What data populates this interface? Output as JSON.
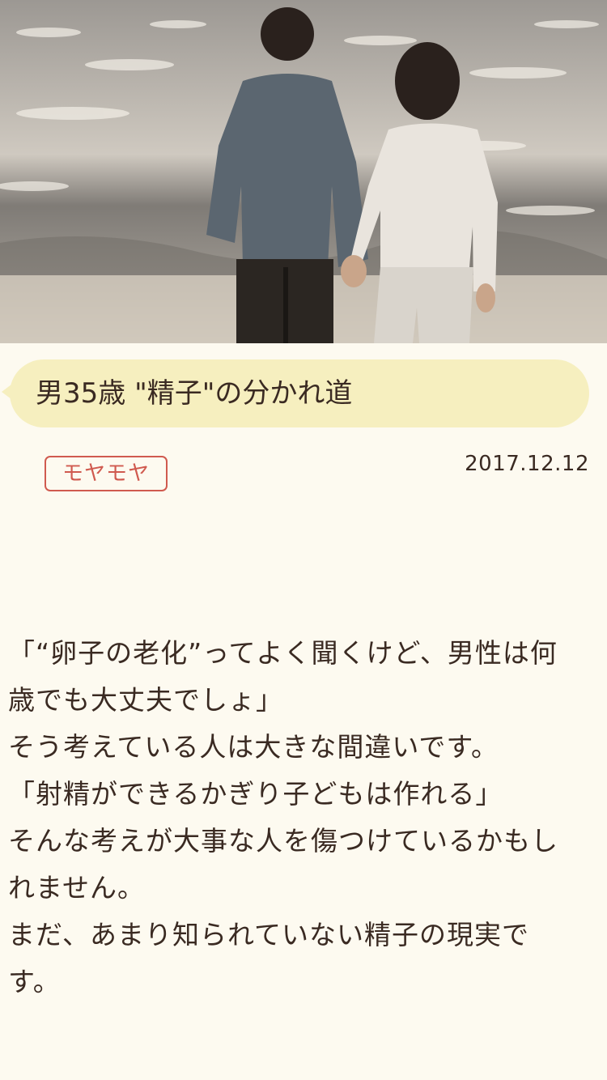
{
  "article": {
    "title": "男35歳 \"精子\"の分かれ道",
    "tag": "モヤモヤ",
    "date": "2017.12.12",
    "image_alt": "海辺で手をつなぐ男女の後ろ姿",
    "body_lines": [
      "「“卵子の老化”ってよく聞くけど、男性は何歳でも大丈夫でしょ」",
      "そう考えている人は大きな間違いです。",
      "「射精ができるかぎり子どもは作れる」",
      "そんな考えが大事な人を傷つけているかもしれません。",
      "まだ、あまり知られていない精子の現実です。"
    ]
  },
  "colors": {
    "background": "#fdfaf0",
    "title_bubble": "#f6efbf",
    "tag_accent": "#d05a4f",
    "text": "#3a2a22"
  }
}
